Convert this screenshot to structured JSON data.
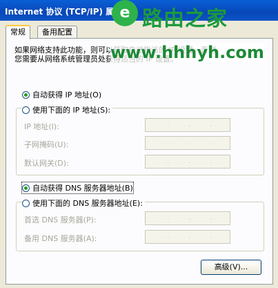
{
  "window": {
    "title": "Internet 协议 (TCP/IP) 属性"
  },
  "tabs": [
    {
      "label": "常规"
    },
    {
      "label": "备用配置"
    }
  ],
  "description": {
    "line1": "如果网络支持此功能，则可以获取自动指派的 IP 设置。否则，",
    "line2": "您需要从网络系统管理员处获得适当的 IP 设置。"
  },
  "ip": {
    "auto_label": "自动获得 IP 地址(O)",
    "manual_label": "使用下面的 IP 地址(S):",
    "auto_selected": true,
    "fields": [
      {
        "label": "IP 地址(I):"
      },
      {
        "label": "子网掩码(U):"
      },
      {
        "label": "默认网关(D):"
      }
    ]
  },
  "dns": {
    "auto_label": "自动获得 DNS 服务器地址(B)",
    "manual_label": "使用下面的 DNS 服务器地址(E):",
    "auto_selected": true,
    "fields": [
      {
        "label": "首选 DNS 服务器(P):"
      },
      {
        "label": "备用 DNS 服务器(A):"
      }
    ]
  },
  "ip_separator": ".",
  "buttons": {
    "advanced": "高级(V)..."
  },
  "watermark": {
    "logo_glyph": "e",
    "brand": "路由之家",
    "url": "www.hhhyh.com"
  },
  "colors": {
    "titlebar": "#0a53c7",
    "radio_selected": "#21a121",
    "watermark_green": "#1d9a3c"
  }
}
